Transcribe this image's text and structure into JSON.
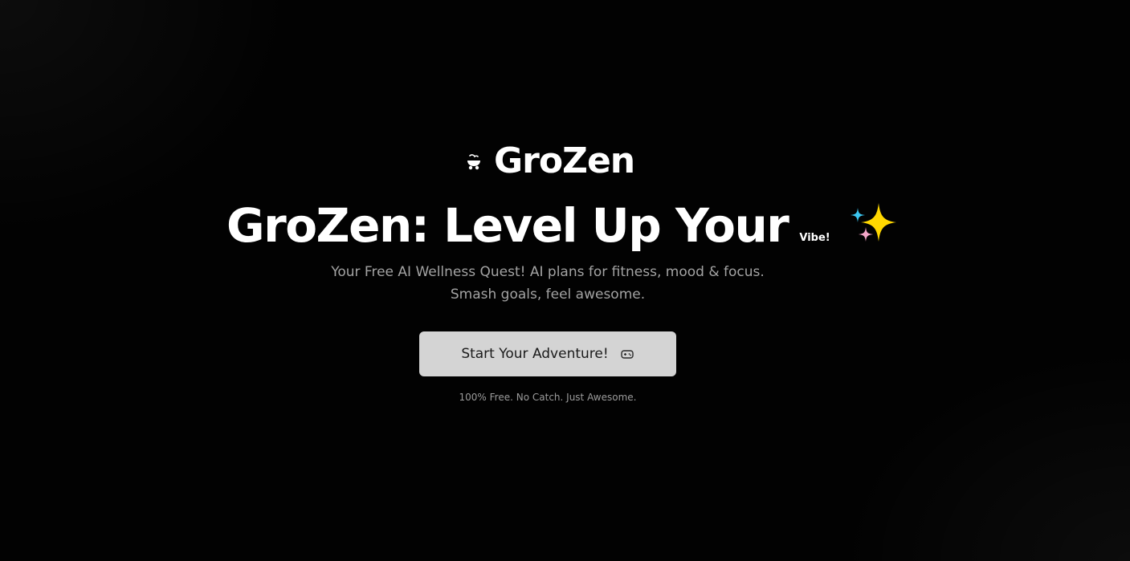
{
  "brand": {
    "name": "GroZen",
    "icon": "bowl-icon"
  },
  "hero": {
    "headline": "GroZen: Level Up Your",
    "headline_suffix": "Vibe!",
    "headline_icon": "sparkles-icon",
    "subtitle_line1": "Your Free AI Wellness Quest! AI plans for fitness, mood & focus.",
    "subtitle_line2": "Smash goals, feel awesome."
  },
  "cta": {
    "label": "Start Your Adventure!",
    "icon": "gamepad-icon"
  },
  "note": "100% Free. No Catch. Just Awesome.",
  "colors": {
    "background": "#020202",
    "button_bg": "#d4d4d4",
    "subtitle_text": "#a3a3a3",
    "sparkle_yellow": "#ffd700",
    "sparkle_blue": "#3cc6f0",
    "sparkle_pink": "#f4a6c8"
  }
}
